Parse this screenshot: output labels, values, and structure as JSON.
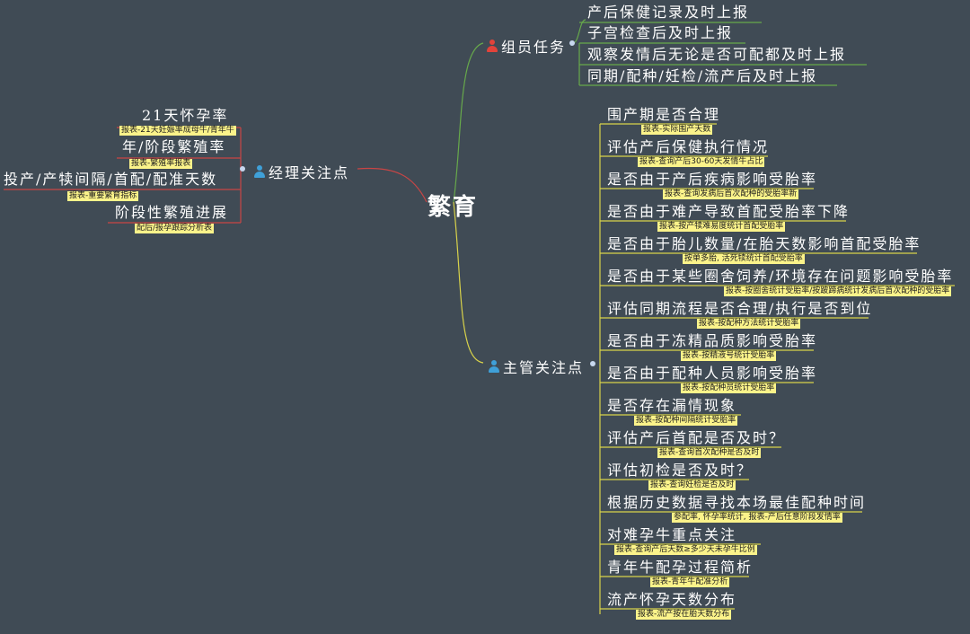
{
  "center": {
    "label": "繁育"
  },
  "colors": {
    "background": "#404b55",
    "tag_bg": "#fbf38a",
    "link_green": "#67a94b",
    "link_yellow": "#d8d24a",
    "link_red": "#c94545",
    "person_red": "#e2433a",
    "person_blue": "#3fa0d8"
  },
  "groups": [
    {
      "label": "组员任务",
      "icon": "person-red-icon",
      "items": [
        {
          "label": "产后保健记录及时上报"
        },
        {
          "label": "子宫检查后及时上报"
        },
        {
          "label": "观察发情后无论是否可配都及时上报"
        },
        {
          "label": "同期/配种/妊检/流产后及时上报"
        }
      ]
    },
    {
      "label": "经理关注点",
      "icon": "person-blue-icon",
      "items": [
        {
          "label": "21天怀孕率",
          "tag": "报表-21天妊娠率成母牛/青年牛"
        },
        {
          "label": "年/阶段繁殖率",
          "tag": "报表-繁殖率报表"
        },
        {
          "label": "投产/产犊间隔/首配/配准天数",
          "tag": "报表-重要繁育指标"
        },
        {
          "label": "阶段性繁殖进展",
          "tag": "配后/报孕跟踪分析表"
        }
      ]
    },
    {
      "label": "主管关注点",
      "icon": "person-blue-icon",
      "items": [
        {
          "label": "围产期是否合理",
          "tag": "报表-实际围产天数"
        },
        {
          "label": "评估产后保健执行情况",
          "tag": "报表-查询产后30-60天发情牛占比"
        },
        {
          "label": "是否由于产后疾病影响受胎率",
          "tag": "报表-查询发病后首次配种的受胎率新"
        },
        {
          "label": "是否由于难产导致首配受胎率下降",
          "tag": "报表-按产犊难易度统计首配受胎率"
        },
        {
          "label": "是否由于胎儿数量/在胎天数影响首配受胎率",
          "tag": "按单多胎, 活死犊统计首配受胎率"
        },
        {
          "label": "是否由于某些圈舍饲养/环境存在问题影响受胎率",
          "tag": "报表-按圈舍统计受胎率/按跛蹄病统计发病后首次配种的受胎率"
        },
        {
          "label": "评估同期流程是否合理/执行是否到位",
          "tag": "报表-按配种方法统计受胎率"
        },
        {
          "label": "是否由于冻精品质影响受胎率",
          "tag": "报表-按精液号统计受胎率"
        },
        {
          "label": "是否由于配种人员影响受胎率",
          "tag": "报表-按配种员统计受胎率"
        },
        {
          "label": "是否存在漏情现象",
          "tag": "报表-按配种间隔统计受胎率"
        },
        {
          "label": "评估产后首配是否及时？",
          "tag": "报表-查询首次配种是否及时"
        },
        {
          "label": "评估初检是否及时？",
          "tag": "报表-查询妊检是否及时"
        },
        {
          "label": "根据历史数据寻找本场最佳配种时间",
          "tag": "参配率, 怀孕率统计, 报表-产后任意阶段发情率"
        },
        {
          "label": "对难孕牛重点关注",
          "tag": "报表-查询产后天数≥多少天未孕牛比例"
        },
        {
          "label": "青年牛配孕过程简析",
          "tag": "报表-青年牛配准分析"
        },
        {
          "label": "流产怀孕天数分布",
          "tag": "报表-流产按在胎天数分布"
        }
      ]
    }
  ]
}
